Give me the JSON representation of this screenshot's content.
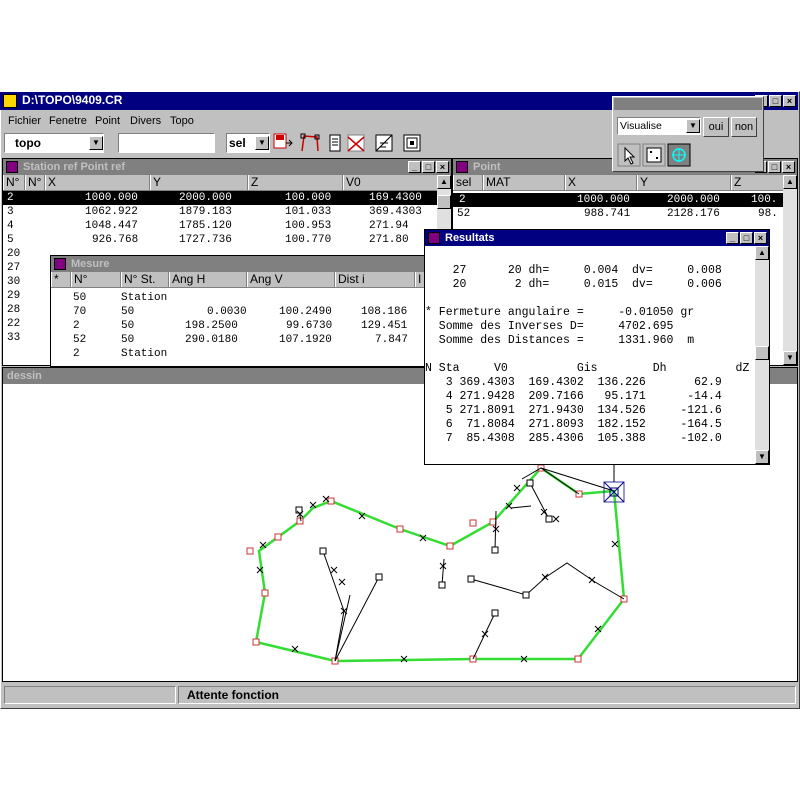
{
  "app": {
    "title": "D:\\TOPO\\9409.CR",
    "menu": [
      "Fichier",
      "Fenetre",
      "Point",
      "Divers",
      "Topo"
    ],
    "combo_value": "topo",
    "text_field_value": "",
    "sel_label": "sel",
    "status_text": "Attente fonction"
  },
  "visualise_panel": {
    "select_value": "Visualise",
    "oui_label": "oui",
    "non_label": "non"
  },
  "station_window": {
    "title": "Station ref Point ref",
    "headers": [
      "N°",
      "N°",
      "X",
      "Y",
      "Z",
      "V0"
    ],
    "rows": [
      [
        "2",
        "",
        "1000.000",
        "2000.000",
        "100.000",
        "169.4300"
      ],
      [
        "3",
        "",
        "1062.922",
        "1879.183",
        "101.033",
        "369.4303"
      ],
      [
        "4",
        "",
        "1048.447",
        "1785.120",
        "100.953",
        "271.94"
      ],
      [
        "5",
        "",
        "926.768",
        "1727.736",
        "100.770",
        "271.80"
      ],
      [
        "20",
        "",
        "",
        "",
        "",
        ""
      ],
      [
        "27",
        "",
        "",
        "",
        "",
        ""
      ],
      [
        "30",
        "",
        "",
        "",
        "",
        ""
      ],
      [
        "29",
        "",
        "",
        "",
        "",
        ""
      ],
      [
        "28",
        "",
        "",
        "",
        "",
        ""
      ],
      [
        "22",
        "",
        "",
        "",
        "",
        ""
      ],
      [
        "33",
        "",
        "",
        "",
        "",
        ""
      ]
    ]
  },
  "mesure_window": {
    "title": "Mesure",
    "headers": [
      "*",
      "N°",
      "N° St.",
      "Ang H",
      "Ang V",
      "Dist i",
      "I"
    ],
    "rows": [
      [
        "",
        "50",
        "Station",
        "",
        "",
        ""
      ],
      [
        "",
        "70",
        "50",
        "0.0030",
        "100.2490",
        "108.186"
      ],
      [
        "",
        "2",
        "50",
        "198.2500",
        "99.6730",
        "129.451"
      ],
      [
        "",
        "52",
        "50",
        "290.0180",
        "107.1920",
        "7.847"
      ],
      [
        "",
        "2",
        "Station",
        "",
        "",
        ""
      ]
    ]
  },
  "point_window": {
    "title": "Point",
    "headers": [
      "sel",
      "MAT",
      "X",
      "Y",
      "Z"
    ],
    "rows": [
      [
        "",
        "2",
        "1000.000",
        "2000.000",
        "100."
      ],
      [
        "",
        "52",
        "988.741",
        "2128.176",
        "98."
      ]
    ]
  },
  "resultats_window": {
    "title": "Resultats",
    "lines": [
      "    27      20 dh=     0.004  dv=     0.008",
      "    20       2 dh=     0.015  dv=     0.006",
      "",
      "* Fermeture angulaire =     -0.01050 gr",
      "  Somme des Inverses D=     4702.695",
      "  Somme des Distances =     1331.960  m",
      "",
      "N Sta     V0          Gis        Dh          dZ",
      "   3 369.4303  169.4302  136.226       62.9",
      "   4 271.9428  209.7166   95.171      -14.4",
      "   5 271.8091  271.9430  134.526     -121.6",
      "   6  71.8084  271.8093  182.152     -164.5",
      "   7  85.4308  285.4306  105.388     -102.0"
    ]
  },
  "dessin_window": {
    "title": "dessin"
  },
  "colors": {
    "titlebar_active": "#000080",
    "traverse_line": "#33dd33",
    "station_marker": "#cc3333",
    "face": "#c0c0c0"
  },
  "icons": [
    "app-icon",
    "save-icon",
    "polyline-icon",
    "calc-icon",
    "cross-tool-icon",
    "hatch-icon",
    "frame-icon",
    "pointer-icon",
    "dots-icon",
    "target-icon"
  ]
}
